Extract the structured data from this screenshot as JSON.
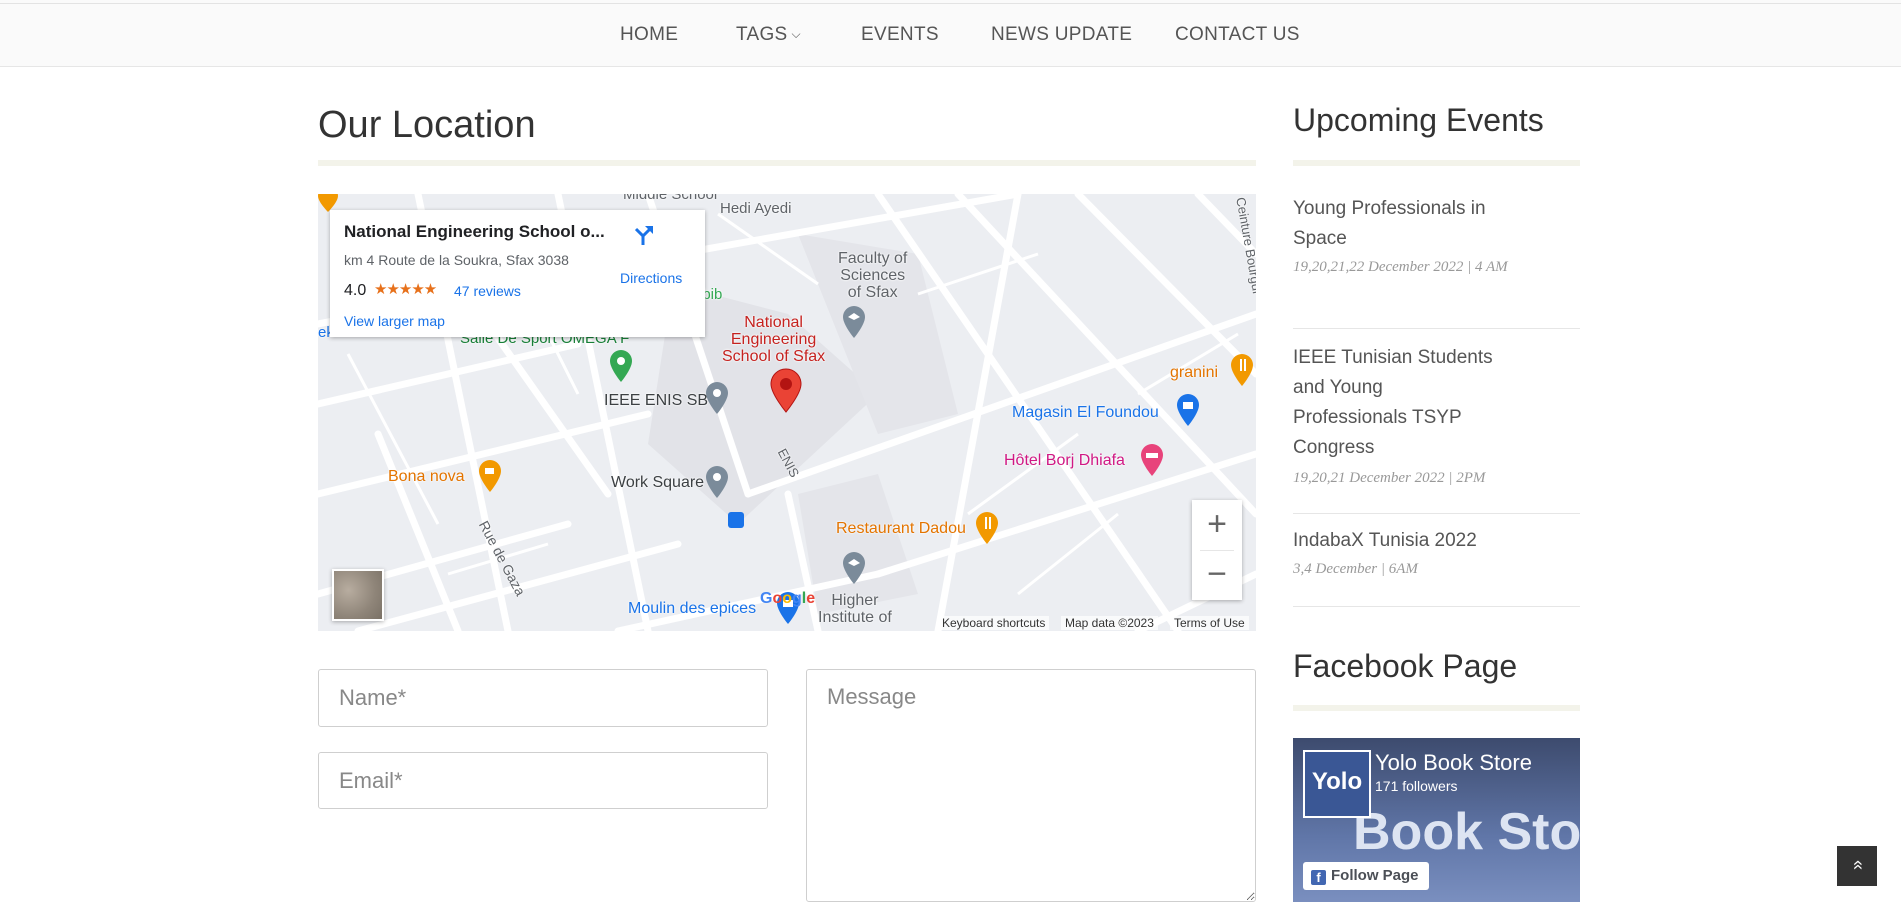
{
  "nav": {
    "items": [
      {
        "label": "HOME"
      },
      {
        "label": "TAGS"
      },
      {
        "label": "EVENTS"
      },
      {
        "label": "NEWS UPDATE"
      },
      {
        "label": "CONTACT US"
      }
    ],
    "tags_chevron": "⌵"
  },
  "main": {
    "title": "Our Location"
  },
  "map": {
    "place_name": "National Engineering School o...",
    "address": "km 4 Route de la Soukra, Sfax 3038",
    "rating": "4.0",
    "stars": "★★★★★",
    "reviews": "47 reviews",
    "larger_map": "View larger map",
    "directions": "Directions",
    "labels": {
      "middle_school": "Middle School",
      "hedi": "Hedi Ayedi",
      "habib": "abib",
      "faculty": "Faculty of\nSciences\nof Sfax",
      "enis": "National\nEngineering\nSchool of Sfax",
      "salle": "Salle De Sport OMEGA F",
      "ieee": "IEEE ENIS SB",
      "granini": "granini",
      "magasin": "Magasin El Foundou",
      "bona": "Bona nova",
      "hotel": "Hôtel Borj Dhiafa",
      "work": "Work Square",
      "restaurant": "Restaurant Dadou",
      "rue": "Rue de Gaza",
      "enis_road": "ENIS",
      "ceinture": "Ceinture Bourgui",
      "higher": "Higher\nInstitute of",
      "moulin": "Moulin des epices",
      "ek": "ek"
    },
    "google": "Google",
    "keyboard": "Keyboard shortcuts",
    "mapdata": "Map data ©2023",
    "terms": "Terms of Use",
    "zoom_in": "+",
    "zoom_out": "−"
  },
  "form": {
    "name_placeholder": "Name*",
    "email_placeholder": "Email*",
    "message_placeholder": "Message"
  },
  "sidebar": {
    "title": "Upcoming Events",
    "events": [
      {
        "title": "Young Professionals in Space",
        "date": "19,20,21,22 December 2022 | 4 AM"
      },
      {
        "title": "IEEE Tunisian Students and Young Professionals TSYP Congress",
        "date": "19,20,21 December 2022 | 2PM"
      },
      {
        "title": "IndabaX Tunisia 2022",
        "date": "3,4 December | 6AM"
      }
    ],
    "fb_title": "Facebook Page",
    "fb": {
      "page_name": "Yolo Book Store",
      "followers": "171 followers",
      "logo_text": "Yolo",
      "cover_text": "Book Sto",
      "follow_button": "Follow Page"
    }
  },
  "back_to_top": "»"
}
